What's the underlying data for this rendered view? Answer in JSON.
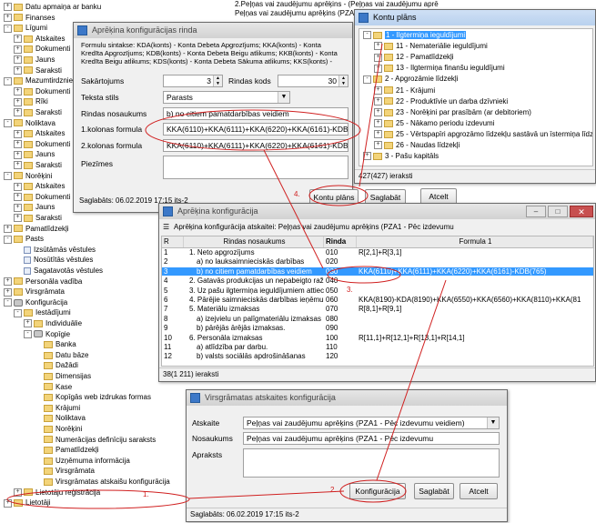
{
  "tree": [
    {
      "label": "Datu apmaiņa ar banku",
      "lvl": 0,
      "pm": "+",
      "icon": "folder"
    },
    {
      "label": "Finanses",
      "lvl": 0,
      "pm": "+",
      "icon": "folder"
    },
    {
      "label": "Līgumi",
      "lvl": 0,
      "pm": "-",
      "icon": "folder"
    },
    {
      "label": "Atskaites",
      "lvl": 1,
      "pm": "+",
      "icon": "folder"
    },
    {
      "label": "Dokumenti",
      "lvl": 1,
      "pm": "+",
      "icon": "folder"
    },
    {
      "label": "Jauns",
      "lvl": 1,
      "pm": "+",
      "icon": "folder"
    },
    {
      "label": "Saraksti",
      "lvl": 1,
      "pm": "+",
      "icon": "folder"
    },
    {
      "label": "Mazumtirdzniecība",
      "lvl": 0,
      "pm": "-",
      "icon": "folder"
    },
    {
      "label": "Dokumenti",
      "lvl": 1,
      "pm": "+",
      "icon": "folder"
    },
    {
      "label": "Rīki",
      "lvl": 1,
      "pm": "+",
      "icon": "folder"
    },
    {
      "label": "Saraksti",
      "lvl": 1,
      "pm": "+",
      "icon": "folder"
    },
    {
      "label": "Noliktava",
      "lvl": 0,
      "pm": "-",
      "icon": "folder"
    },
    {
      "label": "Atskaites",
      "lvl": 1,
      "pm": "+",
      "icon": "folder"
    },
    {
      "label": "Dokumenti",
      "lvl": 1,
      "pm": "+",
      "icon": "folder"
    },
    {
      "label": "Jauns",
      "lvl": 1,
      "pm": "+",
      "icon": "folder"
    },
    {
      "label": "Saraksti",
      "lvl": 1,
      "pm": "+",
      "icon": "folder"
    },
    {
      "label": "Norēķini",
      "lvl": 0,
      "pm": "-",
      "icon": "folder"
    },
    {
      "label": "Atskaites",
      "lvl": 1,
      "pm": "+",
      "icon": "folder"
    },
    {
      "label": "Dokumenti",
      "lvl": 1,
      "pm": "+",
      "icon": "folder"
    },
    {
      "label": "Jauns",
      "lvl": 1,
      "pm": "+",
      "icon": "folder"
    },
    {
      "label": "Saraksti",
      "lvl": 1,
      "pm": "+",
      "icon": "folder"
    },
    {
      "label": "Pamatlīdzekļi",
      "lvl": 0,
      "pm": "+",
      "icon": "folder"
    },
    {
      "label": "Pasts",
      "lvl": 0,
      "pm": "-",
      "icon": "folder"
    },
    {
      "label": "Izsūtāmās vēstules",
      "lvl": 1,
      "pm": "",
      "icon": "doc"
    },
    {
      "label": "Nosūtītās vēstules",
      "lvl": 1,
      "pm": "",
      "icon": "doc"
    },
    {
      "label": "Sagatavotās vēstules",
      "lvl": 1,
      "pm": "",
      "icon": "doc"
    },
    {
      "label": "Personāla vadība",
      "lvl": 0,
      "pm": "+",
      "icon": "folder"
    },
    {
      "label": "Virsgrāmata",
      "lvl": 0,
      "pm": "+",
      "icon": "folder"
    },
    {
      "label": "Konfigurācija",
      "lvl": 0,
      "pm": "-",
      "icon": "gear"
    },
    {
      "label": "Iestādījumi",
      "lvl": 1,
      "pm": "-",
      "icon": "folder"
    },
    {
      "label": "Individuālie",
      "lvl": 2,
      "pm": "+",
      "icon": "folder"
    },
    {
      "label": "Kopīgie",
      "lvl": 2,
      "pm": "-",
      "icon": "gear"
    },
    {
      "label": "Banka",
      "lvl": 3,
      "pm": "",
      "icon": "folder"
    },
    {
      "label": "Datu bāze",
      "lvl": 3,
      "pm": "",
      "icon": "folder"
    },
    {
      "label": "Dažādi",
      "lvl": 3,
      "pm": "",
      "icon": "folder"
    },
    {
      "label": "Dimensijas",
      "lvl": 3,
      "pm": "",
      "icon": "folder"
    },
    {
      "label": "Kase",
      "lvl": 3,
      "pm": "",
      "icon": "folder"
    },
    {
      "label": "Kopīgās web izdrukas formas",
      "lvl": 3,
      "pm": "",
      "icon": "folder"
    },
    {
      "label": "Krājumi",
      "lvl": 3,
      "pm": "",
      "icon": "folder"
    },
    {
      "label": "Noliktava",
      "lvl": 3,
      "pm": "",
      "icon": "folder"
    },
    {
      "label": "Norēķini",
      "lvl": 3,
      "pm": "",
      "icon": "folder"
    },
    {
      "label": "Numerācijas definīciju saraksts",
      "lvl": 3,
      "pm": "",
      "icon": "folder"
    },
    {
      "label": "Pamatlīdzekļi",
      "lvl": 3,
      "pm": "",
      "icon": "folder"
    },
    {
      "label": "Uzņēmuma informācija",
      "lvl": 3,
      "pm": "",
      "icon": "folder"
    },
    {
      "label": "Virsgrāmata",
      "lvl": 3,
      "pm": "",
      "icon": "folder"
    },
    {
      "label": "Virsgrāmatas atskaišu konfigurācija",
      "lvl": 3,
      "pm": "",
      "icon": "folder"
    },
    {
      "label": "Lietotāju reģistrācija",
      "lvl": 1,
      "pm": "+",
      "icon": "folder"
    },
    {
      "label": "Lietotāji",
      "lvl": 0,
      "pm": "+",
      "icon": "folder"
    }
  ],
  "bg_report": {
    "line1": "2.Peļņas vai zaudējumu aprēķins - (Peļņas vai zaudējumu aprē",
    "line2": "Peļņas vai zaudējumu aprēķins (PZA1 - Pēc izdevumu veidiem)"
  },
  "rinda_dialog": {
    "title": "Aprēķina konfigurācijas rinda",
    "syntax": "Formulu sintakse: KDA(konts) - Konta Debeta Apgrozījums; KKA(konts) - Konta Kredīta Apgrozījums; KDB(konts) - Konta Debeta Beigu atlikums; KKB(konts) - Konta Kredīta Beigu atlikums; KDS(konts) - Konta Debeta Sākuma atlikums; KKS(konts) - Konta Kredīta Sākuma atlikums; R[sakārtojums, kolona] - Atsauce uz rindu",
    "sakartojums_label": "Sakārtojums",
    "sakartojums_value": "3",
    "rindas_kods_label": "Rindas kods",
    "rindas_kods_value": "30",
    "teksta_stils_label": "Teksta stils",
    "teksta_stils_value": "Parasts",
    "rindas_nosaukums_label": "Rindas nosaukums",
    "rindas_nosaukums_value": "b) no citiem pamatdarbības veidiem",
    "formula1_label": "1.kolonas formula",
    "formula1_value": "KKA(6110)+KKA(6111)+KKA(6220)+KKA(6161)-KDB(765)",
    "formula2_label": "2.kolonas formula",
    "formula2_value": "KKA(6110)+KKA(6111)+KKA(6220)+KKA(6161)-KDB(765)",
    "piezimes_label": "Piezīmes",
    "status": "Saglabāts: 06.02.2019 17:15 its-2",
    "step": "4.",
    "btn_kontu": "Kontu plāns",
    "btn_saglabat": "Saglabāt",
    "btn_atcelt": "Atcelt"
  },
  "kontu": {
    "title": "Kontu plāns",
    "items": [
      {
        "label": "1 - Ilgtermiņa ieguldījumi",
        "lvl": 0,
        "pm": "-",
        "sel": true
      },
      {
        "label": "11 - Nemateriālie ieguldījumi",
        "lvl": 1,
        "pm": "+",
        "sel": false
      },
      {
        "label": "12 - Pamatlīdzekļi",
        "lvl": 1,
        "pm": "+",
        "sel": false
      },
      {
        "label": "13 - Ilgtermiņa finanšu ieguldījumi",
        "lvl": 1,
        "pm": "+",
        "sel": false
      },
      {
        "label": "2 - Apgrozāmie līdzekļi",
        "lvl": 0,
        "pm": "-",
        "sel": false
      },
      {
        "label": "21 - Krājumi",
        "lvl": 1,
        "pm": "+",
        "sel": false
      },
      {
        "label": "22 - Produktīvie un darba dzīvnieki",
        "lvl": 1,
        "pm": "+",
        "sel": false
      },
      {
        "label": "23 - Norēķini par prasībām (ar debitoriem)",
        "lvl": 1,
        "pm": "+",
        "sel": false
      },
      {
        "label": "25 - Nākamo periodu izdevumi",
        "lvl": 1,
        "pm": "+",
        "sel": false
      },
      {
        "label": "25 - Vērtspapīri apgrozāmo līdzekļu sastāvā un īstermiņa līdzd",
        "lvl": 1,
        "pm": "+",
        "sel": false
      },
      {
        "label": "26 - Naudas līdzekļi",
        "lvl": 1,
        "pm": "+",
        "sel": false
      },
      {
        "label": "3 - Pašu kapitāls",
        "lvl": 0,
        "pm": "+",
        "sel": false
      }
    ],
    "status": "427(427) ieraksti"
  },
  "aprek": {
    "title": "Aprēķina konfigurācija",
    "subtitle": "Aprēķina konfigurācija atskaitei: Peļņas vai zaudējumu aprēķins (PZA1 - Pēc izdevumu",
    "headers": {
      "r": "R",
      "name": "Rindas nosaukums",
      "rinda": "Rinda",
      "f1": "Formula 1"
    },
    "rows": [
      {
        "r": "1",
        "name": "1. Neto apgrozījums",
        "rinda": "010",
        "f1": "R[2,1]+R[3,1]",
        "sel": false
      },
      {
        "r": "2",
        "name": "a) no lauksaimnieciskās darbības",
        "rinda": "020",
        "f1": "",
        "sel": false
      },
      {
        "r": "3",
        "name": "b) no citiem pamatdarbības veidiem",
        "rinda": "030",
        "f1": "KKA(6110)+KKA(6111)+KKA(6220)+KKA(6161)-KDB(765)",
        "sel": true
      },
      {
        "r": "4",
        "name": "2. Gatavās produkcijas un nepabeigto ražo",
        "rinda": "040",
        "f1": "",
        "sel": false
      },
      {
        "r": "5",
        "name": "3. Uz pašu ilgtermiņa ieguldījumiem attiecinā",
        "rinda": "050",
        "f1": "",
        "sel": false
      },
      {
        "r": "6",
        "name": "4. Pārējie saimnieciskās darbības ieņēmumi",
        "rinda": "060",
        "f1": "KKA(8190)-KDA(8190)+KKA(6550)+KKA(6560)+KKA(8110)+KKA(81",
        "sel": false
      },
      {
        "r": "7",
        "name": "5. Materiālu izmaksas",
        "rinda": "070",
        "f1": "R[8,1]+R[9,1]",
        "sel": false
      },
      {
        "r": "8",
        "name": "a) izejvielu un palīgmateriālu izmaksas",
        "rinda": "080",
        "f1": "",
        "sel": false
      },
      {
        "r": "9",
        "name": "b) pārējās ārējās izmaksas.",
        "rinda": "090",
        "f1": "",
        "sel": false
      },
      {
        "r": "10",
        "name": "6. Personāla izmaksas",
        "rinda": "100",
        "f1": "R[11,1]+R[12,1]+R[13,1]+R[14,1]",
        "sel": false
      },
      {
        "r": "11",
        "name": "a) atlīdzība par darbu.",
        "rinda": "110",
        "f1": "",
        "sel": false
      },
      {
        "r": "12",
        "name": "b) valsts sociālās apdrošināšanas",
        "rinda": "120",
        "f1": "",
        "sel": false
      }
    ],
    "status": "38(1 211) ieraksti",
    "step": "3."
  },
  "virs": {
    "title": "Virsgrāmatas atskaites konfigurācija",
    "atskaite_label": "Atskaite",
    "atskaite_value": "Peļņas vai zaudējumu aprēķins (PZA1 - Pēc izdevumu veidiem)",
    "nosaukums_label": "Nosaukums",
    "nosaukums_value": "Peļņas vai zaudējumu aprēķins (PZA1 - Pēc izdevumu",
    "apraksts_label": "Apraksts",
    "status": "Saglabāts: 06.02.2019 17:15 its-2",
    "step": "2.",
    "btn_konfig": "Konfigurācija",
    "btn_saglabat": "Saglabāt",
    "btn_atcelt": "Atcelt"
  },
  "tree_step": "1.",
  "colors": {
    "highlight": "#3399ff",
    "annotation": "#d02020"
  }
}
